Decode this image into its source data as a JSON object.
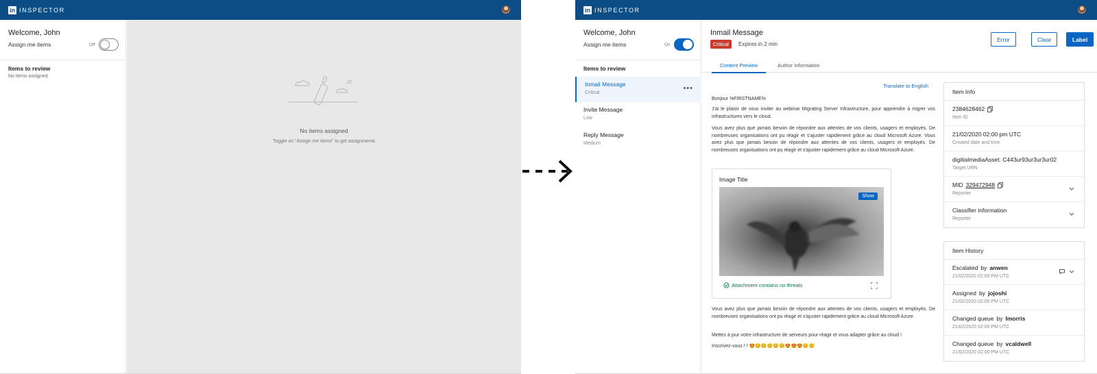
{
  "app": {
    "brand": "INSPECTOR",
    "logo": "in"
  },
  "left_screen": {
    "welcome": "Welcome, John",
    "assign_label": "Assign me items",
    "toggle_state": "Off",
    "items_title": "Items to review",
    "items_empty": "No items assigned",
    "empty_title": "No items assigned",
    "empty_subtitle": "Toggle on \"Assign me items\" to get assignments"
  },
  "right_screen": {
    "welcome": "Welcome, John",
    "assign_label": "Assign me items",
    "toggle_state": "On",
    "items_title": "Items to review",
    "items": [
      {
        "title": "Inmail Message",
        "severity": "Critical"
      },
      {
        "title": "Invite Message",
        "severity": "Low"
      },
      {
        "title": "Reply Message",
        "severity": "Medium"
      }
    ],
    "more_icon": "•••",
    "header": {
      "title": "Inmail Message",
      "badge": "Critical",
      "expires": "Expires in 2 min",
      "buttons": {
        "error": "Error",
        "clear": "Clear",
        "label": "Label"
      }
    },
    "tabs": [
      "Content Preview",
      "Author Information"
    ],
    "translate": "Translate to English",
    "message": {
      "greeting": "Bonjour %FIRSTNAME%",
      "p1": "J'ai le plaisir de vous inviter au webinar Migrating Server Infrastructure, pour apprendre à migrer vos infrastructures vers le cloud.",
      "p2": "Vous avez plus que jamais besoin de répondre aux attentes de vos clients, usagers et employés. De nombreuses organisations ont pu réagir et s'ajuster rapidement grâce au cloud Microsoft Azure. Vous avez plus que jamais besoin de répondre aux attentes de vos clients, usagers et employés. De nombreuses organisations ont pu réagir et s'ajuster rapidement grâce au cloud Microsoft Azure.",
      "p3": "Vous avez plus que jamais besoin de répondre aux attentes de vos clients, usagers et employés. De nombreuses organisations ont pu réagir et s'ajuster rapidement grâce au cloud Microsoft Azure.",
      "p4": "Mettez à jour votre infrastructure de serveurs pour réagir et vous adapter grâce au cloud !",
      "p5": "Inscrivez-vous ! ! 😍😊😊😊😊😊😍😍😍😊😊"
    },
    "image_card": {
      "title": "Image Title",
      "show": "Show",
      "status": "Attachment contains no threats"
    },
    "item_info": {
      "title": "Item Info",
      "rows": [
        {
          "value": "2384628462",
          "label": "Item ID"
        },
        {
          "value": "21/02/2020 02:00 pm UTC",
          "label": "Created date and time"
        },
        {
          "value": "digitialmediaAsset: C443ur93ur3ur3ur02",
          "label": "Target URN"
        },
        {
          "value_prefix": "MID",
          "value": "329472948",
          "label": "Reporter"
        },
        {
          "value": "Classifier information",
          "label": "Reporter"
        }
      ]
    },
    "item_history": {
      "title": "Item History",
      "by": "by",
      "rows": [
        {
          "action": "Escalated",
          "user": "anwen",
          "time": "21/02/2020 02:00 PM UTC"
        },
        {
          "action": "Assigned",
          "user": "jojoshi",
          "time": "21/02/2020 02:00 PM UTC"
        },
        {
          "action": "Changed queue",
          "user": "lmorris",
          "time": "21/02/2020 02:00 PM UTC"
        },
        {
          "action": "Changed queue",
          "user": "vcaldwell",
          "time": "21/02/2020 02:00 PM UTC"
        }
      ]
    }
  },
  "colors": {
    "header": "#0b4d84",
    "accent": "#0a66c2",
    "critical": "#cc3a2f",
    "success": "#057642"
  }
}
